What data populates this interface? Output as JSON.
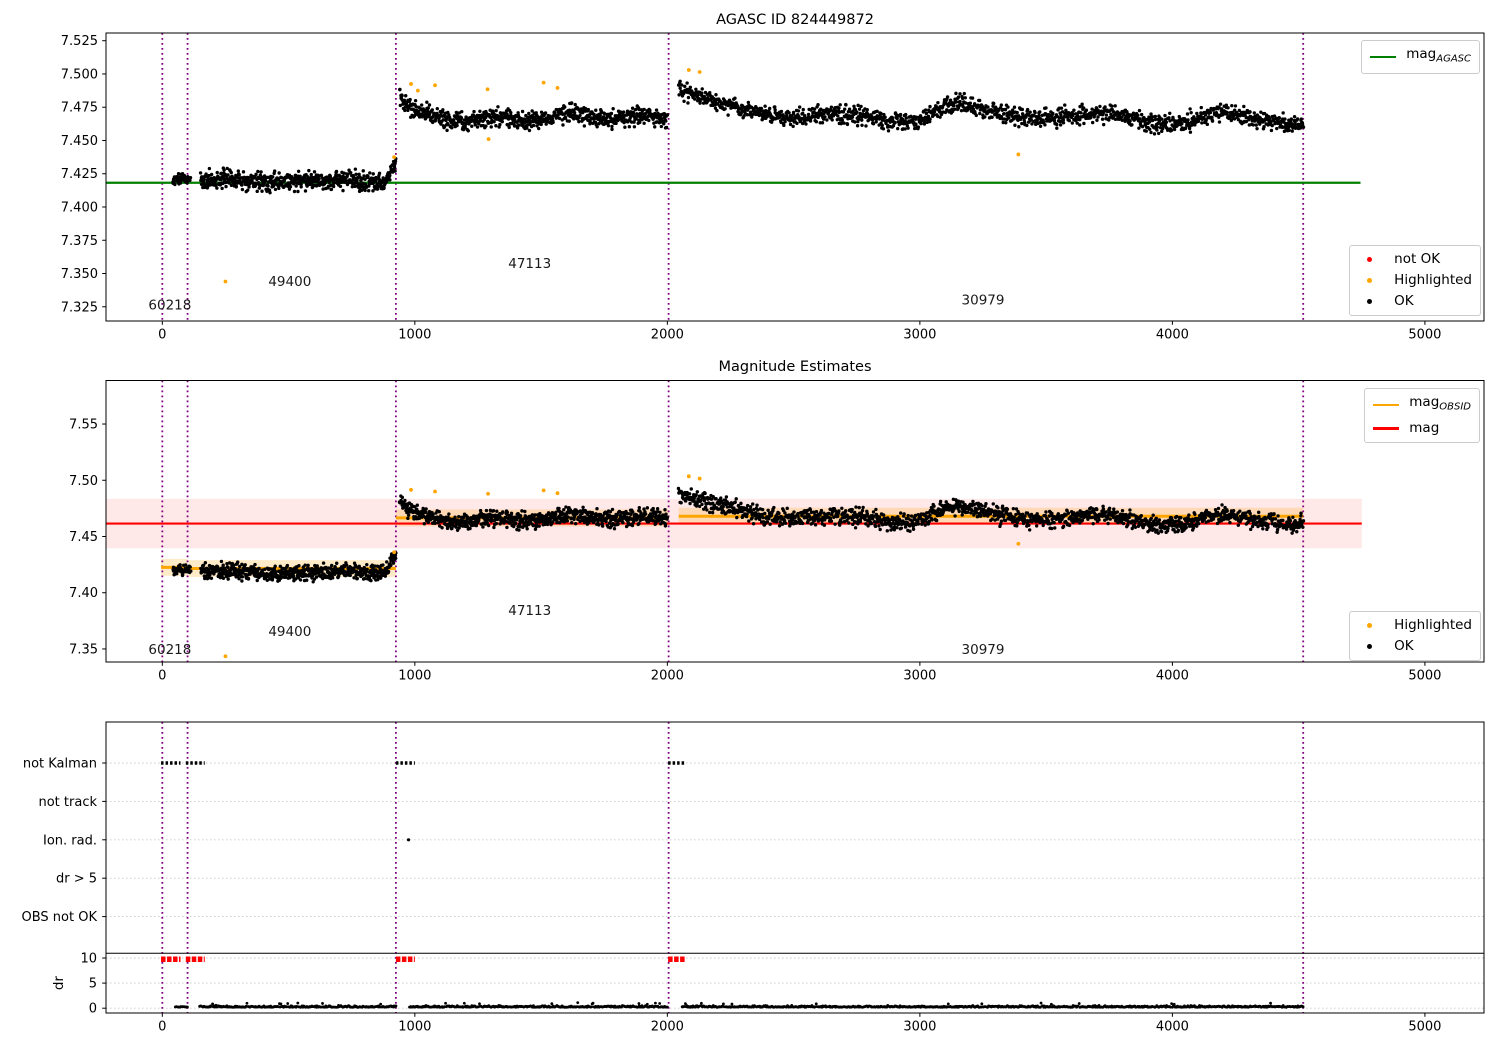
{
  "figure": {
    "background": "#ffffff",
    "colors": {
      "ok": "#000000",
      "not_ok": "#ff0000",
      "highlighted": "#ffa500",
      "mag_agasc_line": "#008000",
      "mag_line": "#ff0000",
      "mag_obsid_line": "#ffa500",
      "obsid_boundary": "#800080",
      "grid": "#c8c8c8",
      "mag_band": "rgba(255,0,0,0.09)",
      "obsid_band": "rgba(255,165,0,0.22)",
      "axis": "#000000"
    }
  },
  "chart_data": [
    {
      "id": "top-magnitude",
      "type": "scatter",
      "title": "AGASC ID 824449872",
      "xlim": [
        -223,
        5234
      ],
      "ylim": [
        7.3143,
        7.5308
      ],
      "xticks": [
        "0",
        "1000",
        "2000",
        "3000",
        "4000",
        "5000"
      ],
      "yticks": [
        "7.325",
        "7.350",
        "7.375",
        "7.400",
        "7.425",
        "7.450",
        "7.475",
        "7.500",
        "7.525"
      ],
      "grid": false,
      "hlines": [
        {
          "name": "mag_agasc",
          "y": 7.4182,
          "x0": -223,
          "x1": 4745,
          "color": "#008000",
          "width": 2.2
        }
      ],
      "vlines": {
        "x": [
          0,
          100,
          925,
          2005,
          4518
        ],
        "color": "#800080"
      },
      "legend_top_right": [
        {
          "icon": "line",
          "color": "#008000",
          "main": "mag",
          "sub": "AGASC"
        }
      ],
      "legend_bottom_right": [
        {
          "icon": "dot",
          "color": "#ff0000",
          "label": "not OK"
        },
        {
          "icon": "dot",
          "color": "#ffa500",
          "label": "Highlighted"
        },
        {
          "icon": "dot",
          "color": "#000000",
          "label": "OK"
        }
      ],
      "annotations": [
        {
          "text": "60218",
          "x": 30,
          "y": 7.3265
        },
        {
          "text": "49400",
          "x": 505,
          "y": 7.344
        },
        {
          "text": "47113",
          "x": 1455,
          "y": 7.3575
        },
        {
          "text": "30979",
          "x": 3250,
          "y": 7.33
        }
      ],
      "ok_segments": [
        {
          "obsid": "60218",
          "x0": 42,
          "x1": 112,
          "n": 46,
          "base": 7.4213,
          "noise": 0.0042,
          "slope": 0,
          "waves": [],
          "bumps": [],
          "decay": null
        },
        {
          "obsid": "49400",
          "x0": 152,
          "x1": 925,
          "n": 600,
          "base": 7.4193,
          "noise": 0.0062,
          "slope": 0,
          "waves": [
            {
              "period": 430,
              "amp": 0.0012,
              "phase": 0
            }
          ],
          "bumps": [
            {
              "x": 922,
              "amp": 0.0145,
              "w": 18
            }
          ],
          "decay": null
        },
        {
          "obsid": "47113",
          "x0": 940,
          "x1": 2000,
          "n": 800,
          "base": 7.467,
          "noise": 0.0062,
          "slope": 0,
          "waves": [
            {
              "period": 300,
              "amp": 0.002,
              "phase": 0
            },
            {
              "period": 800,
              "amp": 0.0018,
              "phase": 2
            }
          ],
          "bumps": [],
          "decay": {
            "amp": 0.0145,
            "tau": 40
          }
        },
        {
          "obsid": "30979",
          "x0": 2045,
          "x1": 4518,
          "n": 1500,
          "base": 7.4705,
          "noise": 0.0062,
          "slope": -2.4e-06,
          "waves": [
            {
              "period": 520,
              "amp": 0.003,
              "phase": 0
            },
            {
              "period": 1300,
              "amp": 0.0025,
              "phase": 1
            }
          ],
          "bumps": [
            {
              "x": 3120,
              "amp": 0.0085,
              "w": 70
            },
            {
              "x": 4160,
              "amp": 0.006,
              "w": 90
            }
          ],
          "decay": {
            "amp": 0.0155,
            "tau": 120
          }
        }
      ],
      "highlighted_points": [
        [
          250,
          7.344
        ],
        [
          918,
          7.4375
        ],
        [
          985,
          7.4925
        ],
        [
          1012,
          7.4875
        ],
        [
          1080,
          7.4915
        ],
        [
          1288,
          7.4885
        ],
        [
          1292,
          7.451
        ],
        [
          1510,
          7.4935
        ],
        [
          1565,
          7.4895
        ],
        [
          2085,
          7.503
        ],
        [
          2128,
          7.5015
        ],
        [
          3390,
          7.4395
        ]
      ],
      "not_ok_points": []
    },
    {
      "id": "magnitude-estimates",
      "type": "scatter",
      "title": "Magnitude Estimates",
      "xlim": [
        -223,
        5234
      ],
      "ylim": [
        7.3384,
        7.5887
      ],
      "xticks": [
        "0",
        "1000",
        "2000",
        "3000",
        "4000",
        "5000"
      ],
      "yticks": [
        "7.35",
        "7.40",
        "7.45",
        "7.50",
        "7.55"
      ],
      "grid": false,
      "mag_band": {
        "y0": 7.4395,
        "y1": 7.4835,
        "x0": -223,
        "x1": 4750
      },
      "hlines": [
        {
          "name": "mag",
          "y": 7.4615,
          "x0": -223,
          "x1": 4750,
          "color": "#ff0000",
          "width": 2.2
        }
      ],
      "obsid_lines": [
        {
          "obsid": "60218",
          "x0": -5,
          "x1": 100,
          "y": 7.4225
        },
        {
          "obsid": "49400",
          "x0": 104,
          "x1": 925,
          "y": 7.4215
        },
        {
          "obsid": "47113",
          "x0": 925,
          "x1": 2005,
          "y": 7.4665
        },
        {
          "obsid": "30979",
          "x0": 2045,
          "x1": 4518,
          "y": 7.468
        }
      ],
      "obsid_band_halfwidth": 0.0075,
      "vlines": {
        "x": [
          0,
          100,
          925,
          2005,
          4518
        ],
        "color": "#800080"
      },
      "legend_top_right": [
        {
          "icon": "line",
          "color": "#ffa500",
          "main": "mag",
          "sub": "OBSID"
        },
        {
          "icon": "line",
          "color": "#ff0000",
          "main": "mag",
          "sub": ""
        }
      ],
      "legend_bottom_right": [
        {
          "icon": "dot",
          "color": "#ffa500",
          "label": "Highlighted"
        },
        {
          "icon": "dot",
          "color": "#000000",
          "label": "OK"
        }
      ],
      "annotations": [
        {
          "text": "60218",
          "x": 30,
          "y": 7.3495
        },
        {
          "text": "49400",
          "x": 505,
          "y": 7.3655
        },
        {
          "text": "47113",
          "x": 1455,
          "y": 7.384
        },
        {
          "text": "30979",
          "x": 3250,
          "y": 7.3495
        }
      ],
      "ok_segments": [
        {
          "obsid": "60218",
          "x0": 42,
          "x1": 112,
          "n": 46,
          "base": 7.4205,
          "noise": 0.0044,
          "slope": 0,
          "waves": [],
          "bumps": [],
          "decay": null
        },
        {
          "obsid": "49400",
          "x0": 152,
          "x1": 925,
          "n": 600,
          "base": 7.4183,
          "noise": 0.0064,
          "slope": 0,
          "waves": [
            {
              "period": 430,
              "amp": 0.0012,
              "phase": 0
            }
          ],
          "bumps": [
            {
              "x": 922,
              "amp": 0.0145,
              "w": 18
            }
          ],
          "decay": null
        },
        {
          "obsid": "47113",
          "x0": 940,
          "x1": 2000,
          "n": 800,
          "base": 7.4658,
          "noise": 0.0066,
          "slope": 0,
          "waves": [
            {
              "period": 300,
              "amp": 0.002,
              "phase": 0
            },
            {
              "period": 800,
              "amp": 0.0018,
              "phase": 2
            }
          ],
          "bumps": [],
          "decay": {
            "amp": 0.0145,
            "tau": 40
          }
        },
        {
          "obsid": "30979",
          "x0": 2045,
          "x1": 4518,
          "n": 1500,
          "base": 7.4695,
          "noise": 0.0068,
          "slope": -2.8e-06,
          "waves": [
            {
              "period": 520,
              "amp": 0.003,
              "phase": 0
            },
            {
              "period": 1300,
              "amp": 0.0025,
              "phase": 1
            }
          ],
          "bumps": [
            {
              "x": 3120,
              "amp": 0.0085,
              "w": 70
            },
            {
              "x": 4160,
              "amp": 0.006,
              "w": 90
            }
          ],
          "decay": {
            "amp": 0.0155,
            "tau": 120
          }
        }
      ],
      "highlighted_points": [
        [
          250,
          7.3435
        ],
        [
          918,
          7.436
        ],
        [
          985,
          7.4915
        ],
        [
          1080,
          7.49
        ],
        [
          1290,
          7.488
        ],
        [
          1510,
          7.491
        ],
        [
          1565,
          7.4885
        ],
        [
          2085,
          7.5035
        ],
        [
          2128,
          7.5015
        ],
        [
          3390,
          7.4435
        ]
      ],
      "not_ok_points": []
    },
    {
      "id": "flags",
      "type": "flags",
      "xlim": [
        -223,
        5234
      ],
      "xticks": [
        "0",
        "1000",
        "2000",
        "3000",
        "4000",
        "5000"
      ],
      "flag_rows": [
        "not Kalman",
        "not track",
        "Ion. rad.",
        "dr > 5",
        "OBS not OK"
      ],
      "flag_dash_segments": {
        "row": 0,
        "ranges": [
          [
            -5,
            72
          ],
          [
            93,
            168
          ],
          [
            925,
            1000
          ],
          [
            2003,
            2070
          ]
        ]
      },
      "flag_points": {
        "row": 2,
        "x": [
          975
        ]
      },
      "dr_axis": {
        "label": "dr",
        "ticks": [
          "10",
          "5",
          "0"
        ],
        "separator_value": 10.95
      },
      "dr_red_segments": {
        "y": 9.75,
        "ranges": [
          [
            -5,
            72
          ],
          [
            93,
            168
          ],
          [
            925,
            1000
          ],
          [
            2003,
            2070
          ]
        ],
        "color": "#ff0000"
      },
      "dr_scatter": {
        "ranges": [
          [
            52,
            100
          ],
          [
            148,
            925
          ],
          [
            978,
            2000
          ],
          [
            2058,
            4518
          ]
        ],
        "base": 0.18,
        "spread": 0.45,
        "density": 0.3
      },
      "vlines": {
        "x": [
          0,
          100,
          925,
          2005,
          4518
        ],
        "color": "#800080"
      }
    }
  ]
}
